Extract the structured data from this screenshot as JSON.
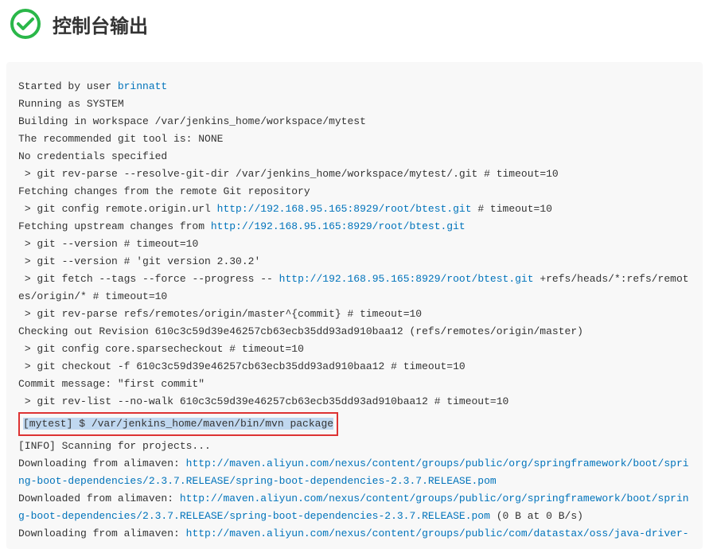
{
  "header": {
    "title": "控制台输出"
  },
  "console": {
    "line1_prefix": "Started by user ",
    "line1_user": "brinnatt",
    "line2": "Running as SYSTEM",
    "line3": "Building in workspace /var/jenkins_home/workspace/mytest",
    "line4": "The recommended git tool is: NONE",
    "line5": "No credentials specified",
    "line6": " > git rev-parse --resolve-git-dir /var/jenkins_home/workspace/mytest/.git # timeout=10",
    "line7": "Fetching changes from the remote Git repository",
    "line8_prefix": " > git config remote.origin.url ",
    "line8_url": "http://192.168.95.165:8929/root/btest.git",
    "line8_suffix": " # timeout=10",
    "line9_prefix": "Fetching upstream changes from ",
    "line9_url": "http://192.168.95.165:8929/root/btest.git",
    "line10": " > git --version # timeout=10",
    "line11": " > git --version # 'git version 2.30.2'",
    "line12_prefix": " > git fetch --tags --force --progress -- ",
    "line12_url": "http://192.168.95.165:8929/root/btest.git",
    "line12_suffix": " +refs/heads/*:refs/remotes/origin/* # timeout=10",
    "line13": " > git rev-parse refs/remotes/origin/master^{commit} # timeout=10",
    "line14": "Checking out Revision 610c3c59d39e46257cb63ecb35dd93ad910baa12 (refs/remotes/origin/master)",
    "line15": " > git config core.sparsecheckout # timeout=10",
    "line16": " > git checkout -f 610c3c59d39e46257cb63ecb35dd93ad910baa12 # timeout=10",
    "line17": "Commit message: \"first commit\"",
    "line18": " > git rev-list --no-walk 610c3c59d39e46257cb63ecb35dd93ad910baa12 # timeout=10",
    "line19_highlighted": "[mytest] $ /var/jenkins_home/maven/bin/mvn package",
    "line20": "[INFO] Scanning for projects...",
    "line21_prefix": "Downloading from alimaven: ",
    "line21_url": "http://maven.aliyun.com/nexus/content/groups/public/org/springframework/boot/spring-boot-dependencies/2.3.7.RELEASE/spring-boot-dependencies-2.3.7.RELEASE.pom",
    "line22_prefix": "Downloaded from alimaven: ",
    "line22_url": "http://maven.aliyun.com/nexus/content/groups/public/org/springframework/boot/spring-boot-dependencies/2.3.7.RELEASE/spring-boot-dependencies-2.3.7.RELEASE.pom",
    "line22_suffix": " (0 B at 0 B/s)",
    "line23_prefix": "Downloading from alimaven: ",
    "line23_url": "http://maven.aliyun.com/nexus/content/groups/public/com/datastax/oss/java-driver-"
  }
}
